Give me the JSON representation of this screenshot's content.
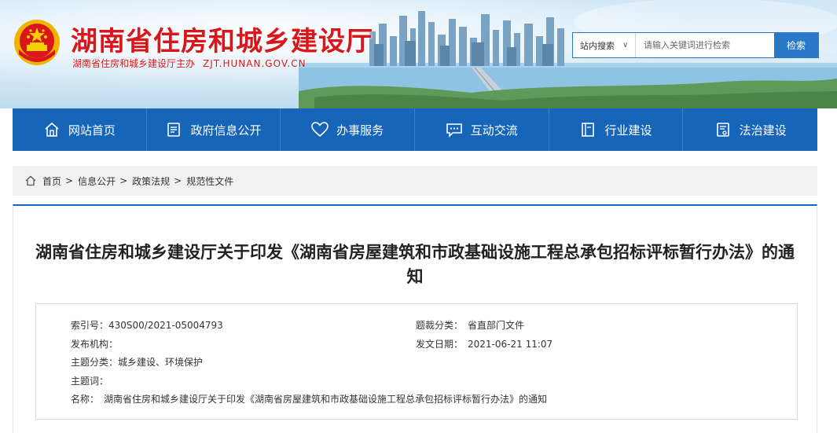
{
  "header": {
    "site_title": "湖南省住房和城乡建设厅",
    "site_sub": "湖南省住房和城乡建设厅主办",
    "site_url": "ZJT.HUNAN.GOV.CN",
    "colors": {
      "title_red": "#d8161b",
      "accent_blue": "#1665b9"
    }
  },
  "search": {
    "scope_label": "站内搜索",
    "placeholder": "请输入关键词进行检索",
    "button_label": "检索"
  },
  "nav": {
    "items": [
      {
        "label": "网站首页",
        "icon": "home-icon"
      },
      {
        "label": "政府信息公开",
        "icon": "document-icon"
      },
      {
        "label": "办事服务",
        "icon": "heart-icon"
      },
      {
        "label": "互动交流",
        "icon": "chat-icon"
      },
      {
        "label": "行业建设",
        "icon": "book-icon"
      },
      {
        "label": "法治建设",
        "icon": "law-icon"
      }
    ]
  },
  "breadcrumb": {
    "items": [
      "首页",
      "信息公开",
      "政策法规",
      "规范性文件"
    ],
    "separator": ">"
  },
  "article": {
    "title": "湖南省住房和城乡建设厅关于印发《湖南省房屋建筑和市政基础设施工程总承包招标评标暂行办法》的通知",
    "meta": {
      "index_label": "索引号：",
      "index_value": "430S00/2021-05004793",
      "category_label": "题裁分类：",
      "category_value": "省直部门文件",
      "issuer_label": "发布机构：",
      "issuer_value": "",
      "date_label": "发文日期：",
      "date_value": "2021-06-21 11:07",
      "topic_label": "主题分类：",
      "topic_value": "城乡建设、环境保护",
      "keywords_label": "主题词：",
      "keywords_value": "",
      "name_label": "名称：",
      "name_value": "湖南省住房和城乡建设厅关于印发《湖南省房屋建筑和市政基础设施工程总承包招标评标暂行办法》的通知"
    }
  }
}
